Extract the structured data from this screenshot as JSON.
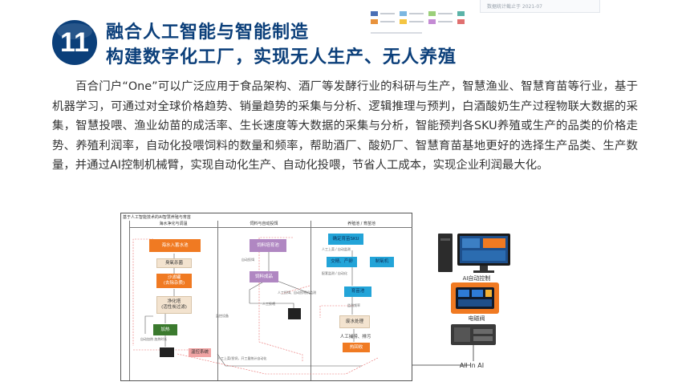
{
  "section": {
    "number": "11",
    "title_line1": "融合人工智能与智能制造",
    "title_line2": "构建数字化工厂，实现无人生产、无人养殖"
  },
  "top_thumbnails": {
    "legend_swatches": [
      "#4a6fb5",
      "#e8923c",
      "#7bb6e0",
      "#f4c542",
      "#9bcf7a",
      "#c48bd4"
    ],
    "card_text": "数据统计截止于 2021-07"
  },
  "body_text": "百合门户“One”可以广泛应用于食品架构、酒厂等发酵行业的科研与生产，智慧渔业、智慧育苗等行业，基于机器学习，可通过对全球价格趋势、销量趋势的采集与分析、逻辑推理与预判，白酒酸奶生产过程物联大数据的采集，智慧投喂、渔业幼苗的成活率、生长速度等大数据的采集与分析，智能预判各SKU养殖或生产的品类的价格走势、养殖利润率，自动化投喂饲料的数量和频率，帮助酒厂、酸奶厂、智慧育苗基地更好的选择生产品类、生产数量，并通过AI控制机械臂，实现自动化生产、自动化投喂，节省人工成本，实现企业利润最大化。",
  "diagram": {
    "title": "基于人工智能技术的AI智慧养殖与育苗",
    "lanes": [
      "海水净化与调温",
      "饲料与自动投饵",
      "养殖池 / 育苗池"
    ],
    "boxes": {
      "seawater_pool": "海水入蓄水池",
      "ozone": "臭氧杀菌",
      "sand_filter": "沙滤罐\n(去除杂质)",
      "purify_tower": "净化塔\n(活性炭过滤)",
      "heating": "加热",
      "feed_pool": "饲料培育池",
      "feed_adult": "饲料成品",
      "pick_sku": "确定育苗SKU",
      "breed": "交精、产卵",
      "hatchery": "制氧机",
      "seedling_pool": "育苗池",
      "waste": "废水处理",
      "harvest": "人工捕捞、排污",
      "harvest_btn": "热回收",
      "bottom_left": "温控系统"
    },
    "notes": {
      "n1": "自动投饵",
      "n2": "人工投饵、自动投喂机监测",
      "n3": "人工投喂",
      "n4": "监控设备",
      "n5": "人工上菜 / 自动监测",
      "n6": "人工上菜/投饲，开工量统计自动化",
      "n7": "配套监测 / 自动化",
      "n8": "监测频率",
      "n9": "自动加热 加热时长"
    }
  },
  "devices": {
    "ai_control": "AI自动控制",
    "electrode": "电磁阀",
    "all_in_ai": "All In AI"
  }
}
